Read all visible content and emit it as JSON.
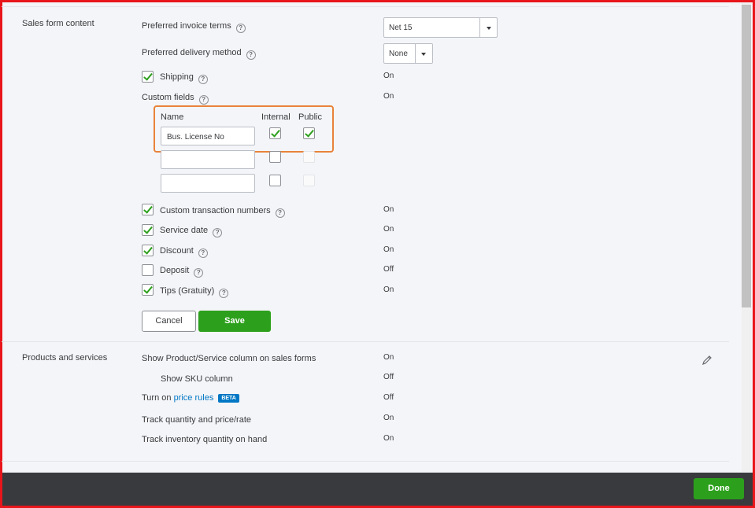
{
  "sales_form_content": {
    "section_label": "Sales form content",
    "invoice_terms": {
      "label": "Preferred invoice terms",
      "value": "Net 15"
    },
    "delivery_method": {
      "label": "Preferred delivery method",
      "value": "None"
    },
    "shipping": {
      "label": "Shipping",
      "checked": true,
      "value": "On"
    },
    "custom_fields": {
      "label": "Custom fields",
      "value": "On",
      "header_name": "Name",
      "header_internal": "Internal",
      "header_public": "Public",
      "rows": [
        {
          "name": "Bus. License No",
          "internal": true,
          "public": true
        },
        {
          "name": "",
          "internal": false,
          "public": false
        },
        {
          "name": "",
          "internal": false,
          "public": false
        }
      ]
    },
    "custom_transaction_numbers": {
      "label": "Custom transaction numbers",
      "checked": true,
      "value": "On"
    },
    "service_date": {
      "label": "Service date",
      "checked": true,
      "value": "On"
    },
    "discount": {
      "label": "Discount",
      "checked": true,
      "value": "On"
    },
    "deposit": {
      "label": "Deposit",
      "checked": false,
      "value": "Off"
    },
    "tips": {
      "label": "Tips (Gratuity)",
      "checked": true,
      "value": "On"
    },
    "cancel_label": "Cancel",
    "save_label": "Save"
  },
  "products_and_services": {
    "section_label": "Products and services",
    "show_product_column": {
      "label": "Show Product/Service column on sales forms",
      "value": "On"
    },
    "show_sku": {
      "label": "Show SKU column",
      "value": "Off"
    },
    "price_rules": {
      "prefix": "Turn on",
      "link": "price rules",
      "badge": "BETA",
      "value": "Off"
    },
    "track_quantity": {
      "label": "Track quantity and price/rate",
      "value": "On"
    },
    "track_inventory": {
      "label": "Track inventory quantity on hand",
      "value": "On"
    }
  },
  "footer": {
    "done_label": "Done"
  },
  "colors": {
    "accent_green": "#2ca01c",
    "link_blue": "#0077c5",
    "highlight_orange": "#e8833a",
    "frame_red": "#e8161b"
  }
}
